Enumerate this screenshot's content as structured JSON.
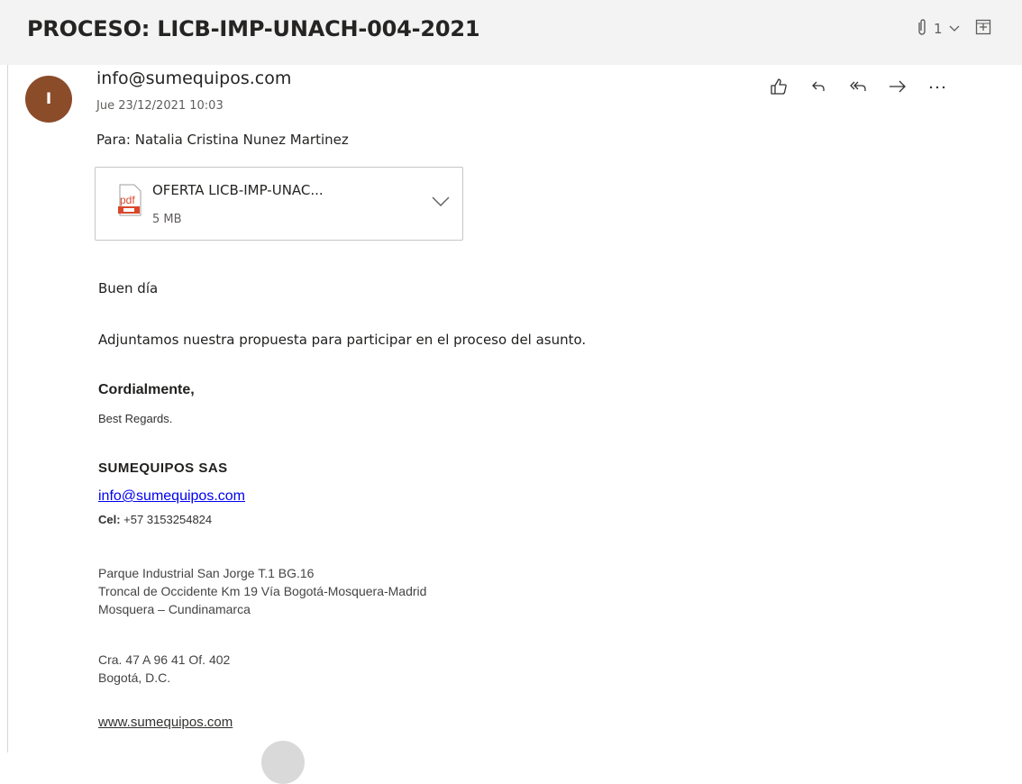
{
  "email": {
    "subject": "PROCESO: LICB-IMP-UNACH-004-2021",
    "attachment_count": "1",
    "sender": {
      "initial": "I",
      "address": "info@sumequipos.com",
      "avatar_color": "#8b4c2a"
    },
    "date": "Jue 23/12/2021 10:03",
    "to_line": "Para:  Natalia Cristina Nunez Martinez",
    "attachment": {
      "icon_label": "pdf",
      "name": "OFERTA LICB-IMP-UNAC...",
      "size": "5 MB"
    },
    "body": {
      "greeting": "Buen día",
      "message": "Adjuntamos nuestra propuesta para participar en el proceso del asunto."
    },
    "signature": {
      "closing": "Cordialmente,",
      "closing_en": "Best Regards.",
      "company": "SUMEQUIPOS SAS",
      "email": "info@sumequipos.com",
      "cel_label": "Cel:",
      "cel_value": " +57 3153254824",
      "address1": [
        "Parque Industrial San Jorge T.1 BG.16",
        "Troncal de Occidente Km 19 Vía Bogotá-Mosquera-Madrid",
        "Mosquera – Cundinamarca"
      ],
      "address2": [
        "Cra. 47 A 96 41 Of. 402",
        "Bogotá, D.C."
      ],
      "website": "www.sumequipos.com"
    }
  },
  "icons": {
    "header": [
      "paperclip-icon",
      "chevron-down-icon",
      "expand-icon"
    ],
    "actions": [
      "like-icon",
      "reply-icon",
      "reply-all-icon",
      "forward-icon",
      "more-icon"
    ],
    "attachment": [
      "pdf-icon",
      "chevron-down-icon"
    ]
  },
  "colors": {
    "header_bg": "#f3f3f3",
    "pdf_red": "#d9482b",
    "link": "#0000ee"
  }
}
